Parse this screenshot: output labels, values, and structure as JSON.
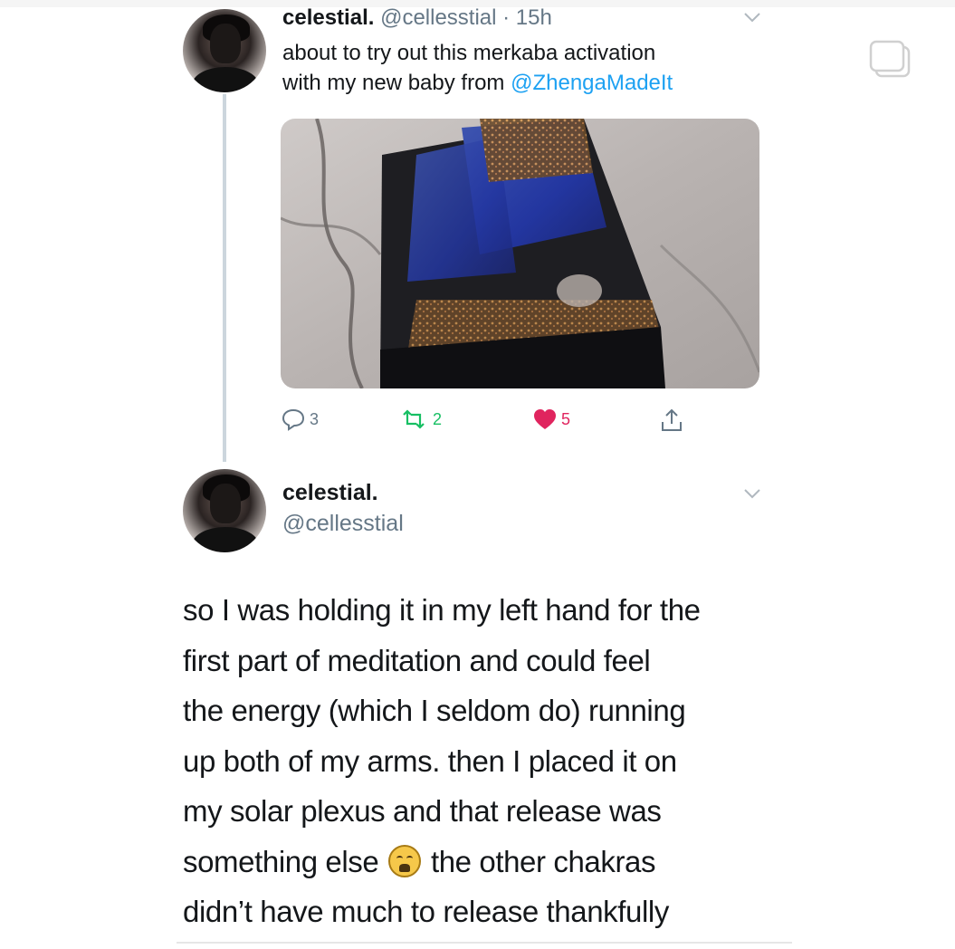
{
  "tweet1": {
    "name": "celestial.",
    "handle_time": "@cellesstial · 15h",
    "text_line1": "about to try out this merkaba activation",
    "text_line2_prefix": "with my new baby from ",
    "mention": "@ZhengaMadeIt",
    "actions": {
      "reply_count": "3",
      "retweet_count": "2",
      "like_count": "5"
    }
  },
  "tweet2": {
    "name": "celestial.",
    "handle": "@cellesstial",
    "lines": [
      "so I was holding it in my left hand for the",
      "first part of meditation and could feel",
      "the energy (which I seldom do) running",
      "up both of my arms. then I placed it on",
      "my solar plexus and that release was",
      "something else",
      "the other chakras",
      "didn’t have much to release thankfully"
    ],
    "emoji": "weary-face"
  },
  "colors": {
    "mention": "#1da1f2",
    "retweet": "#17bf63",
    "like": "#e0245e",
    "muted": "#657786"
  }
}
